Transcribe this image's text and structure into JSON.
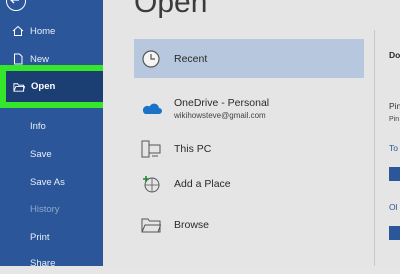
{
  "sidebar": {
    "items": [
      {
        "label": "Home",
        "icon": "home-icon"
      },
      {
        "label": "New",
        "icon": "new-document-icon"
      },
      {
        "label": "Open",
        "icon": "open-folder-icon"
      },
      {
        "label": "Info"
      },
      {
        "label": "Save"
      },
      {
        "label": "Save As"
      },
      {
        "label": "History"
      },
      {
        "label": "Print"
      },
      {
        "label": "Share"
      }
    ]
  },
  "main": {
    "title": "Open",
    "locations": [
      {
        "label": "Recent",
        "icon": "clock-icon"
      },
      {
        "label": "OneDrive - Personal",
        "sublabel": "wikihowsteve@gmail.com",
        "icon": "onedrive-cloud-icon"
      },
      {
        "label": "This PC",
        "icon": "computer-icon"
      },
      {
        "label": "Add a Place",
        "icon": "add-place-globe-icon"
      },
      {
        "label": "Browse",
        "icon": "browse-folder-icon"
      }
    ],
    "right_partial": {
      "tab": "Do",
      "pinned": "Pin",
      "pinned_sub": "Pin",
      "today": "To",
      "older": "Ol"
    }
  },
  "colors": {
    "sidebar_bg": "#2b579a",
    "selected_nav_bg": "#1c3f73",
    "highlight_outline": "#35e62a",
    "selected_location_bg": "#b7c7dd",
    "accent_text": "#2b579a"
  }
}
